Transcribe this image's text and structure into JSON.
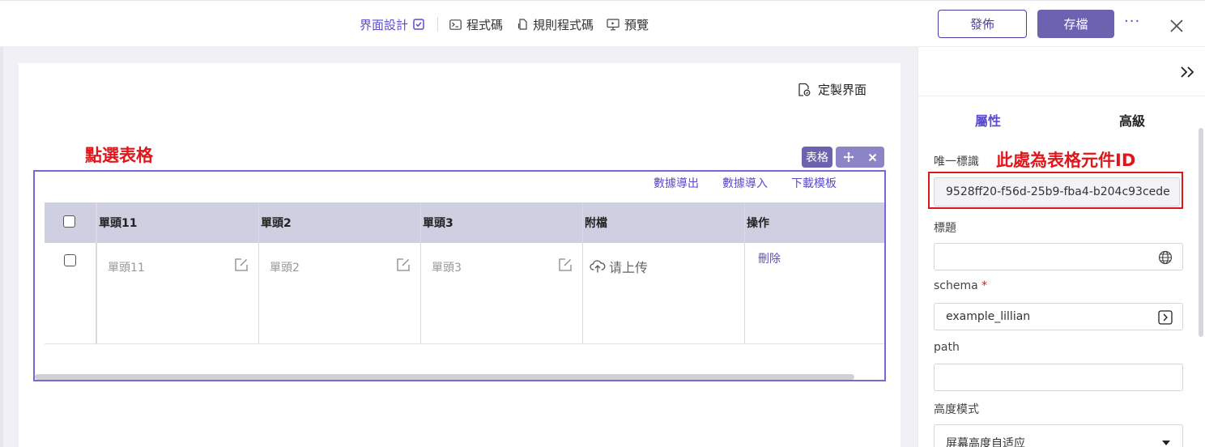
{
  "topbar": {
    "nav": {
      "ui_design": "界面設計",
      "code": "程式碼",
      "rule_code": "規則程式碼",
      "preview": "預覽"
    },
    "publish_label": "發佈",
    "save_label": "存檔",
    "more_label": "···",
    "accent_color": "#5b4ccf"
  },
  "canvas": {
    "custom_ui_label": "定製界面",
    "note_select_table": "點選表格",
    "component_tag": "表格",
    "toolbar_links": {
      "export": "數據導出",
      "import": "數據導入",
      "download_template": "下載模板"
    },
    "table": {
      "columns": [
        "單頭11",
        "單頭2",
        "單頭3",
        "附檔",
        "操作"
      ],
      "rows": [
        {
          "cells": [
            "單頭11",
            "單頭2",
            "單頭3"
          ],
          "upload_label": "请上传",
          "action_label": "刪除"
        }
      ]
    }
  },
  "panel": {
    "tabs": [
      "屬性",
      "高級"
    ],
    "active_tab_index": 0,
    "note_component_id": "此處為表格元件ID",
    "fields": {
      "unique_id_label": "唯一標識",
      "unique_id_value": "9528ff20-f56d-25b9-fba4-b204c93cede",
      "title_label": "標題",
      "title_value": "",
      "schema_label": "schema",
      "schema_required_mark": "*",
      "schema_value": "example_lillian",
      "path_label": "path",
      "path_value": "",
      "height_mode_label": "高度模式",
      "height_mode_value": "屏幕高度自适应"
    }
  },
  "icons": {
    "ui_design": "checkbox-square-icon",
    "code": "terminal-icon",
    "rule_code": "file-code-icon",
    "preview": "monitor-icon",
    "close": "close-icon",
    "custom_ui": "file-edit-icon",
    "move": "move-icon",
    "remove": "close-icon",
    "edit": "edit-icon",
    "upload": "cloud-upload-icon",
    "collapse": "double-chevron-right-icon",
    "globe": "globe-icon",
    "schema": "chevron-right-square-icon",
    "dropdown": "caret-down-icon"
  }
}
